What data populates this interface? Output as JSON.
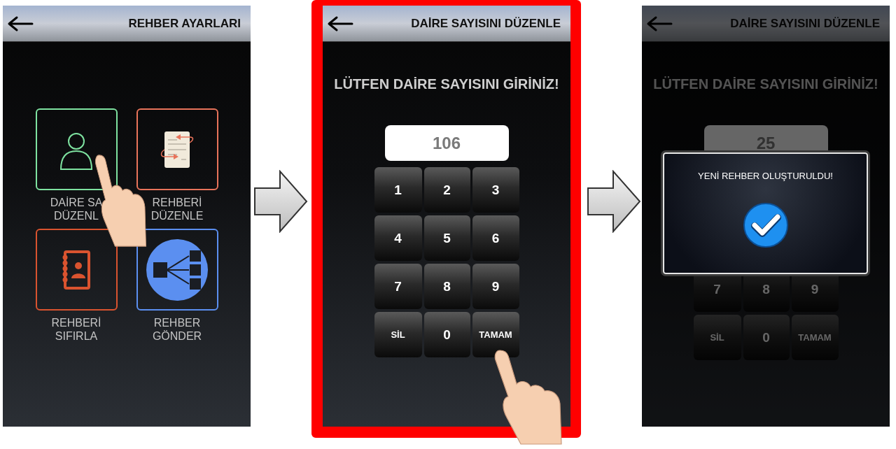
{
  "screens": [
    {
      "kind": "menu",
      "highlighted": false,
      "header": {
        "title": "REHBER AYARLARI"
      },
      "tiles": [
        {
          "label_lines": [
            "DAİRE SA",
            "DÜZENL"
          ],
          "color": "#7ee2a0"
        },
        {
          "label_lines": [
            "REHBERİ",
            "DÜZENLE"
          ],
          "color": "#e8735a"
        },
        {
          "label_lines": [
            "REHBERİ",
            "SIFIRLA"
          ],
          "color": "#d9532f"
        },
        {
          "label_lines": [
            "REHBER",
            "GÖNDER"
          ],
          "color": "#5b8ff0"
        }
      ]
    },
    {
      "kind": "keypad",
      "highlighted": true,
      "header": {
        "title": "DAİRE SAYISINI DÜZENLE"
      },
      "prompt": "LÜTFEN DAİRE SAYISINI GİRİNİZ!",
      "value": "106",
      "keys": [
        {
          "label": "1",
          "kind": "digit"
        },
        {
          "label": "2",
          "kind": "digit"
        },
        {
          "label": "3",
          "kind": "digit"
        },
        {
          "label": "4",
          "kind": "digit"
        },
        {
          "label": "5",
          "kind": "digit"
        },
        {
          "label": "6",
          "kind": "digit"
        },
        {
          "label": "7",
          "kind": "digit"
        },
        {
          "label": "8",
          "kind": "digit"
        },
        {
          "label": "9",
          "kind": "digit"
        },
        {
          "label": "SİL",
          "kind": "action"
        },
        {
          "label": "0",
          "kind": "digit"
        },
        {
          "label": "TAMAM",
          "kind": "action"
        }
      ]
    },
    {
      "kind": "keypad",
      "highlighted": false,
      "header": {
        "title": "DAİRE SAYISINI DÜZENLE"
      },
      "prompt": "LÜTFEN DAİRE SAYISINI GİRİNİZ!",
      "value": "25",
      "keys": [
        {
          "label": "7",
          "kind": "digit"
        },
        {
          "label": "8",
          "kind": "digit"
        },
        {
          "label": "9",
          "kind": "digit"
        },
        {
          "label": "SİL",
          "kind": "action"
        },
        {
          "label": "0",
          "kind": "digit"
        },
        {
          "label": "TAMAM",
          "kind": "action"
        }
      ],
      "dialog": {
        "message": "YENİ REHBER OLUŞTURULDU!"
      }
    }
  ]
}
